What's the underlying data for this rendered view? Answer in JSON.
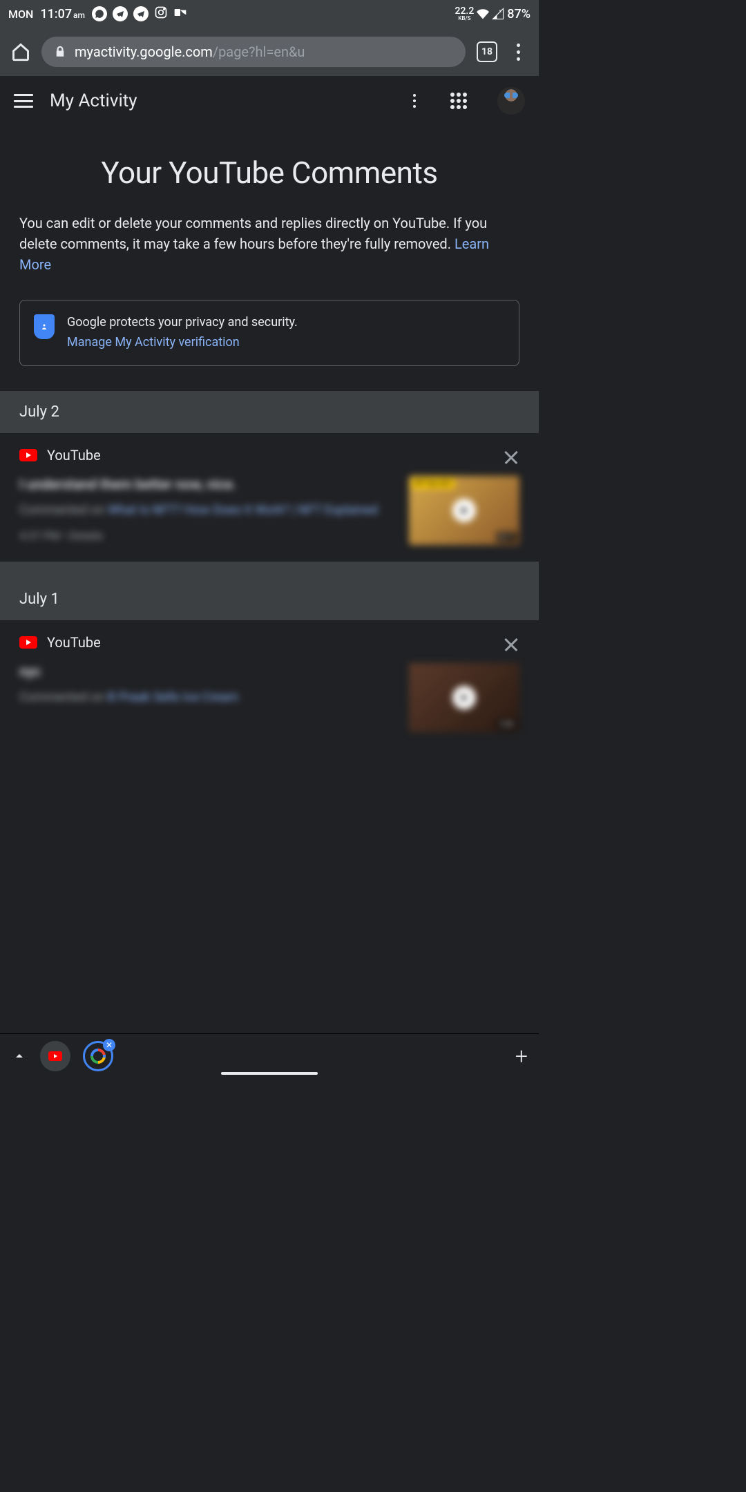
{
  "status": {
    "day": "MON",
    "time": "11:07",
    "ampm": "am",
    "net_value": "22.2",
    "net_unit": "KB/S",
    "battery": "87%"
  },
  "browser": {
    "url_domain": "myactivity.google.com",
    "url_path": "/page?hl=en&u",
    "tab_count": "18"
  },
  "header": {
    "title": "My Activity"
  },
  "page": {
    "title": "Your YouTube Comments",
    "description": "You can edit or delete your comments and replies directly on YouTube. If you delete comments, it may take a few hours before they're fully removed. ",
    "learn_more": "Learn More"
  },
  "privacy": {
    "text": "Google protects your privacy and security.",
    "link": "Manage My Activity verification"
  },
  "dates": {
    "d1": "July 2",
    "d2": "July 1"
  },
  "items": [
    {
      "source": "YouTube",
      "comment": "I understand them better now, nice.",
      "prefix": "Commented on ",
      "video": "What Is NFT? How Does It Work? | NFT Explained",
      "time": "4:37 PM",
      "details": "Details",
      "duration": "8:11",
      "banner": "NFT Kya Hai?"
    },
    {
      "source": "YouTube",
      "comment": "nyc",
      "prefix": "Commented on ",
      "video": "B Praak Sells Ice Cream",
      "time": "",
      "details": "",
      "duration": "5:50",
      "banner": ""
    }
  ]
}
